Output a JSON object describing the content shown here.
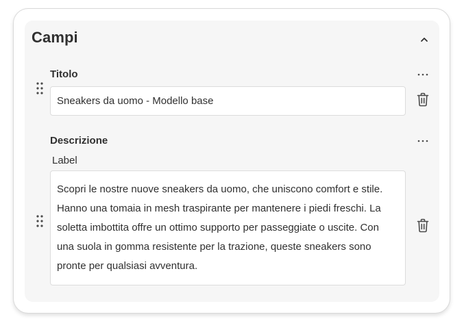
{
  "section": {
    "title": "Campi"
  },
  "fields": [
    {
      "label": "Titolo",
      "value": "Sneakers da uomo - Modello base"
    },
    {
      "label": "Descrizione",
      "sublabel": "Label",
      "value": "Scopri le nostre nuove sneakers da uomo, che uniscono comfort e stile. Hanno una tomaia in mesh traspirante per mantenere i piedi freschi. La soletta imbottita offre un ottimo supporto per passeggiate o uscite. Con una suola in gomma resistente per la trazione, queste sneakers sono pronte per qualsiasi avventura."
    }
  ],
  "icons": {
    "collapse": "chevron-up-icon",
    "more": "more-horizontal-icon",
    "drag": "drag-handle-icon",
    "delete": "trash-icon"
  },
  "colors": {
    "text": "#303030",
    "icon": "#4a4a4a",
    "panel_bg": "#f6f6f6",
    "border": "#dcdcdc"
  }
}
